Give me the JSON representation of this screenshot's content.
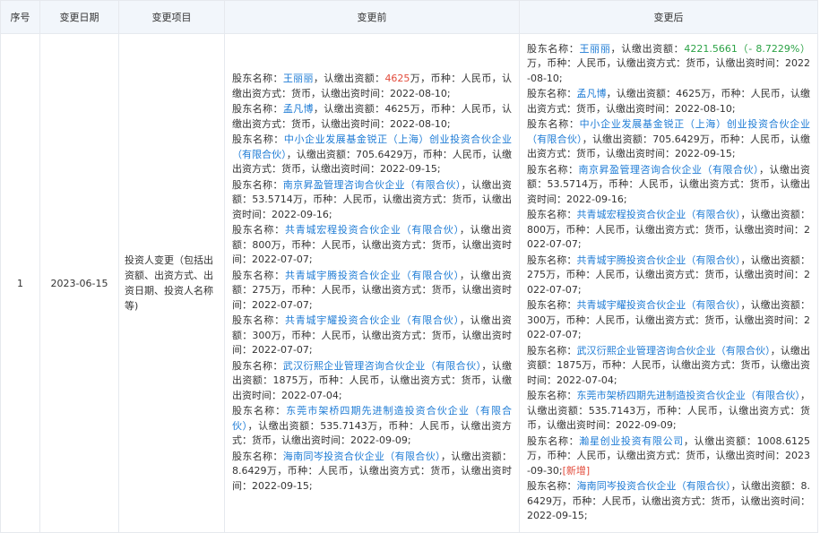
{
  "headers": {
    "index": "序号",
    "date": "变更日期",
    "item": "变更项目",
    "before": "变更前",
    "after": "变更后"
  },
  "row": {
    "index": "1",
    "date": "2023-06-15",
    "item": "投资人变更（包括出资额、出资方式、出资日期、投资人名称等)",
    "before": [
      {
        "p": "股东名称：",
        "name": "王丽丽",
        "m": "，认缴出资额：",
        "amount": "4625",
        "amount_style": "red",
        "rest": "万，币种：人民币，认缴出资方式：货币，认缴出资时间：2022-08-10;"
      },
      {
        "p": "股东名称：",
        "name": "孟凡博",
        "m": "，认缴出资额：",
        "amount": "4625",
        "amount_style": "",
        "rest": "万，币种：人民币，认缴出资方式：货币，认缴出资时间：2022-08-10;"
      },
      {
        "p": "股东名称：",
        "name": "中小企业发展基金锐正（上海）创业投资合伙企业（有限合伙）",
        "m": "，认缴出资额：",
        "amount": "705.6429",
        "amount_style": "",
        "rest": "万，币种：人民币，认缴出资方式：货币，认缴出资时间：2022-09-15;"
      },
      {
        "p": "股东名称：",
        "name": "南京昇盈管理咨询合伙企业（有限合伙）",
        "m": "，认缴出资额：",
        "amount": "53.5714",
        "amount_style": "",
        "rest": "万，币种：人民币，认缴出资方式：货币，认缴出资时间：2022-09-16;"
      },
      {
        "p": "股东名称：",
        "name": "共青城宏程投资合伙企业（有限合伙）",
        "m": "，认缴出资额：",
        "amount": "800",
        "amount_style": "",
        "rest": "万，币种：人民币，认缴出资方式：货币，认缴出资时间：2022-07-07;"
      },
      {
        "p": "股东名称：",
        "name": "共青城宇腾投资合伙企业（有限合伙）",
        "m": "，认缴出资额：",
        "amount": "275",
        "amount_style": "",
        "rest": "万，币种：人民币，认缴出资方式：货币，认缴出资时间：2022-07-07;"
      },
      {
        "p": "股东名称：",
        "name": "共青城宇耀投资合伙企业（有限合伙）",
        "m": "，认缴出资额：",
        "amount": "300",
        "amount_style": "",
        "rest": "万，币种：人民币，认缴出资方式：货币，认缴出资时间：2022-07-07;"
      },
      {
        "p": "股东名称：",
        "name": "武汉衍熙企业管理咨询合伙企业（有限合伙）",
        "m": "，认缴出资额：",
        "amount": "1875",
        "amount_style": "",
        "rest": "万，币种：人民币，认缴出资方式：货币，认缴出资时间：2022-07-04;"
      },
      {
        "p": "股东名称：",
        "name": "东莞市架桥四期先进制造投资合伙企业（有限合伙）",
        "m": "，认缴出资额：",
        "amount": "535.7143",
        "amount_style": "",
        "rest": "万，币种：人民币，认缴出资方式：货币，认缴出资时间：2022-09-09;"
      },
      {
        "p": "股东名称：",
        "name": "海南同岑投资合伙企业（有限合伙）",
        "m": "，认缴出资额：",
        "amount": "8.6429",
        "amount_style": "",
        "rest": "万，币种：人民币，认缴出资方式：货币，认缴出资时间：2022-09-15;"
      }
    ],
    "after": [
      {
        "p": "股东名称：",
        "name": "王丽丽",
        "m": "，认缴出资额：",
        "amount": "4221.5661（- 8.7229%）",
        "amount_style": "green",
        "rest": "万，币种：人民币，认缴出资方式：货币，认缴出资时间：2022-08-10;",
        "tag": ""
      },
      {
        "p": "股东名称：",
        "name": "孟凡博",
        "m": "，认缴出资额：",
        "amount": "4625",
        "amount_style": "",
        "rest": "万，币种：人民币，认缴出资方式：货币，认缴出资时间：2022-08-10;",
        "tag": ""
      },
      {
        "p": "股东名称：",
        "name": "中小企业发展基金锐正（上海）创业投资合伙企业（有限合伙）",
        "m": "，认缴出资额：",
        "amount": "705.6429",
        "amount_style": "",
        "rest": "万，币种：人民币，认缴出资方式：货币，认缴出资时间：2022-09-15;",
        "tag": ""
      },
      {
        "p": "股东名称：",
        "name": "南京昇盈管理咨询合伙企业（有限合伙）",
        "m": "，认缴出资额：",
        "amount": "53.5714",
        "amount_style": "",
        "rest": "万，币种：人民币，认缴出资方式：货币，认缴出资时间：2022-09-16;",
        "tag": ""
      },
      {
        "p": "股东名称：",
        "name": "共青城宏程投资合伙企业（有限合伙）",
        "m": "，认缴出资额：",
        "amount": "800",
        "amount_style": "",
        "rest": "万，币种：人民币，认缴出资方式：货币，认缴出资时间：2022-07-07;",
        "tag": ""
      },
      {
        "p": "股东名称：",
        "name": "共青城宇腾投资合伙企业（有限合伙）",
        "m": "，认缴出资额：",
        "amount": "275",
        "amount_style": "",
        "rest": "万，币种：人民币，认缴出资方式：货币，认缴出资时间：2022-07-07;",
        "tag": ""
      },
      {
        "p": "股东名称：",
        "name": "共青城宇耀投资合伙企业（有限合伙）",
        "m": "，认缴出资额：",
        "amount": "300",
        "amount_style": "",
        "rest": "万，币种：人民币，认缴出资方式：货币，认缴出资时间：2022-07-07;",
        "tag": ""
      },
      {
        "p": "股东名称：",
        "name": "武汉衍熙企业管理咨询合伙企业（有限合伙）",
        "m": "，认缴出资额：",
        "amount": "1875",
        "amount_style": "",
        "rest": "万，币种：人民币，认缴出资方式：货币，认缴出资时间：2022-07-04;",
        "tag": ""
      },
      {
        "p": "股东名称：",
        "name": "东莞市架桥四期先进制造投资合伙企业（有限合伙）",
        "m": "，认缴出资额：",
        "amount": "535.7143",
        "amount_style": "",
        "rest": "万，币种：人民币，认缴出资方式：货币，认缴出资时间：2022-09-09;",
        "tag": ""
      },
      {
        "p": "股东名称：",
        "name": "瀚星创业投资有限公司",
        "m": "，认缴出资额：",
        "amount": "1008.6125",
        "amount_style": "",
        "rest": "万，币种：人民币，认缴出资方式：货币，认缴出资时间：2023-09-30;",
        "tag": "[新增]"
      },
      {
        "p": "股东名称：",
        "name": "海南同岑投资合伙企业（有限合伙）",
        "m": "，认缴出资额：",
        "amount": "8.6429",
        "amount_style": "",
        "rest": "万，币种：人民币，认缴出资方式：货币，认缴出资时间：2022-09-15;",
        "tag": ""
      }
    ]
  }
}
